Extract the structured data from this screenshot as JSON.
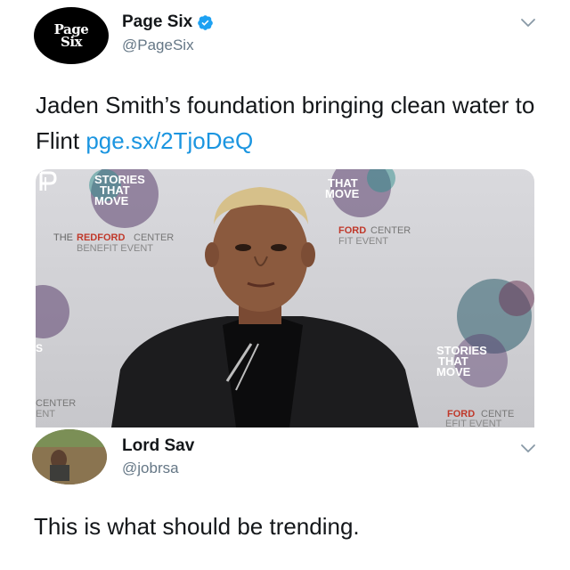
{
  "tweet": {
    "avatar_text_line1": "Page",
    "avatar_text_line2": "Six",
    "display_name": "Page Six",
    "handle": "@PageSix",
    "text_before_link": "Jaden Smith’s foundation bringing clean water to Flint ",
    "link_text": "pge.sx/2TjoDeQ",
    "media": {
      "backdrop_text_1": "STORIES",
      "backdrop_text_2": "THAT",
      "backdrop_text_3": "MOVE",
      "backdrop_the": "THE",
      "backdrop_redford": "REDFORD",
      "backdrop_center": "CENTER",
      "backdrop_benefit": "BENEFIT EVENT",
      "backdrop_ford": "FORD",
      "backdrop_fit_event": "FIT EVENT",
      "backdrop_center_left": "CENTER",
      "backdrop_ent": "ENT",
      "backdrop_fordcente": "FORD",
      "backdrop_cente": "CENTE",
      "backdrop_efit_event": "EFIT EVENT",
      "backdrop_s": "S",
      "logo_icon": "page-six-p-icon"
    }
  },
  "reply": {
    "display_name": "Lord Sav",
    "handle": "@jobrsa",
    "text": "This is what should be trending."
  },
  "colors": {
    "link": "#1b95e0",
    "verified": "#1da1f2",
    "secondary_text": "#657786",
    "primary_text": "#14171a"
  }
}
